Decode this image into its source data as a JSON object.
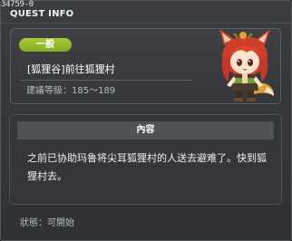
{
  "window": {
    "id_label": "34759-0",
    "title": "QUEST INFO"
  },
  "quest": {
    "badge": "一般",
    "name": "[狐狸谷]前往狐狸村",
    "level_label": "建議等級：",
    "level_range": "185～189"
  },
  "content": {
    "header": "內容",
    "text": "之前已协助玛鲁将尖耳狐狸村的人送去避难了。快到狐狸村去。"
  },
  "status": {
    "label": "狀態：",
    "value": "可開始"
  },
  "colors": {
    "badge_green": "#96b82a",
    "panel_bg": "#3a3c40",
    "text_gray": "#b7bbbf"
  }
}
